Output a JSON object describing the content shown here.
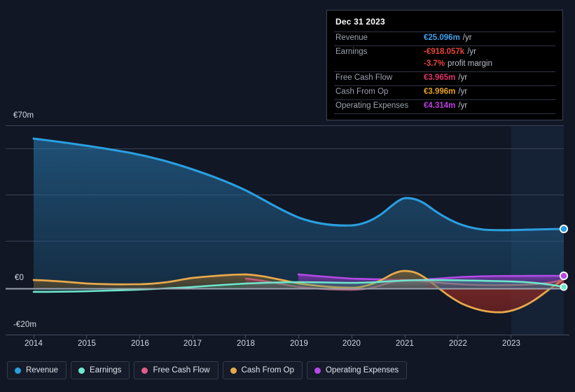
{
  "chart_data": {
    "type": "area",
    "title": "",
    "xlabel": "",
    "ylabel": "",
    "ylim": [
      -20,
      70
    ],
    "ytick_labels": [
      "€70m",
      "€0",
      "-€20m"
    ],
    "ytick_values": [
      70,
      0,
      -20
    ],
    "gridlines": [
      70,
      60,
      40,
      20,
      0
    ],
    "x": [
      2014,
      2015,
      2016,
      2017,
      2018,
      2019,
      2020,
      2021,
      2022,
      2023
    ],
    "xtick_labels": [
      "2014",
      "2015",
      "2016",
      "2017",
      "2018",
      "2019",
      "2020",
      "2021",
      "2022",
      "2023"
    ],
    "legend_position": "bottom",
    "grid": true,
    "currency": "EUR",
    "series": [
      {
        "name": "Revenue",
        "color": "#2a9fe0",
        "values": [
          64.8,
          61.5,
          58.5,
          54.0,
          42.4,
          33.0,
          27.3,
          39.1,
          32.0,
          25.1
        ],
        "last_value": 25.096
      },
      {
        "name": "Earnings",
        "color": "#6fe7cd",
        "values": [
          -1.5,
          -1.4,
          -1.2,
          -0.9,
          -0.4,
          0.6,
          1.0,
          1.4,
          1.9,
          -0.918
        ],
        "last_value": -0.918057
      },
      {
        "name": "Free Cash Flow",
        "color": "#e05c8a",
        "values": [
          null,
          null,
          null,
          null,
          3.0,
          0.9,
          -0.5,
          1.4,
          2.1,
          3.965
        ],
        "last_value": 3.965,
        "starts_at": 2018
      },
      {
        "name": "Cash From Op",
        "color": "#e8a94b",
        "values": [
          3.6,
          2.9,
          2.4,
          3.2,
          3.5,
          1.0,
          0.4,
          6.2,
          -6.5,
          3.996
        ],
        "last_value": 3.996
      },
      {
        "name": "Operating Expenses",
        "color": "#b44ae8",
        "values": [
          null,
          null,
          null,
          null,
          null,
          4.9,
          4.2,
          3.6,
          4.2,
          4.314
        ],
        "last_value": 4.314,
        "starts_at": 2019
      }
    ]
  },
  "tooltip": {
    "title": "Dec 31 2023",
    "rows": [
      {
        "label": "Revenue",
        "value": "€25.096m",
        "unit": "/yr",
        "color": "#3da2f0"
      },
      {
        "label": "Earnings",
        "value": "-€918.057k",
        "unit": "/yr",
        "color": "#e8453c"
      },
      {
        "label": "",
        "value": "-3.7%",
        "unit": "profit margin",
        "color": "#e8453c"
      },
      {
        "label": "Free Cash Flow",
        "value": "€3.965m",
        "unit": "/yr",
        "color": "#e0316b"
      },
      {
        "label": "Cash From Op",
        "value": "€3.996m",
        "unit": "/yr",
        "color": "#e8a020"
      },
      {
        "label": "Operating Expenses",
        "value": "€4.314m",
        "unit": "/yr",
        "color": "#c13ce8"
      }
    ]
  },
  "legend": {
    "items": [
      {
        "label": "Revenue",
        "color": "#2a9fe0"
      },
      {
        "label": "Earnings",
        "color": "#6fe7cd"
      },
      {
        "label": "Free Cash Flow",
        "color": "#e05c8a"
      },
      {
        "label": "Cash From Op",
        "color": "#e8a94b"
      },
      {
        "label": "Operating Expenses",
        "color": "#b44ae8"
      }
    ]
  },
  "axis": {
    "y_top_label": "€70m",
    "y_zero_label": "€0",
    "y_bottom_label": "-€20m",
    "x_labels": [
      "2014",
      "2015",
      "2016",
      "2017",
      "2018",
      "2019",
      "2020",
      "2021",
      "2022",
      "2023"
    ]
  }
}
